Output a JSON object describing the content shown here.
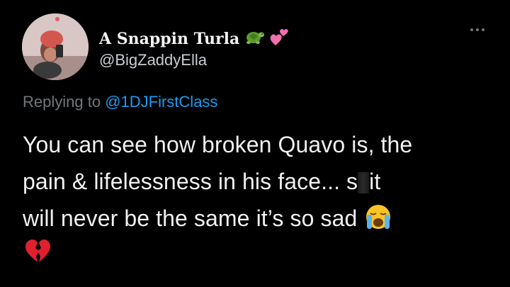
{
  "tweet": {
    "display_name": "A Snappin Turla",
    "name_emojis": [
      "turtle-emoji",
      "two-hearts-emoji"
    ],
    "handle": "@BigZaddyElla",
    "reply_prefix": "Replying to",
    "reply_mention": "@1DJFirstClass",
    "body_lines": [
      "You can see how broken Quavo is, the",
      "pain & lifelessness in his face... s",
      "it",
      "will never be the same it’s so sad"
    ],
    "trailing_emojis": [
      "loudly-crying-face-emoji",
      "broken-heart-emoji"
    ]
  },
  "colors": {
    "background": "#000000",
    "text": "#e7e9ea",
    "muted": "#71767b",
    "link": "#1d9bf0"
  }
}
